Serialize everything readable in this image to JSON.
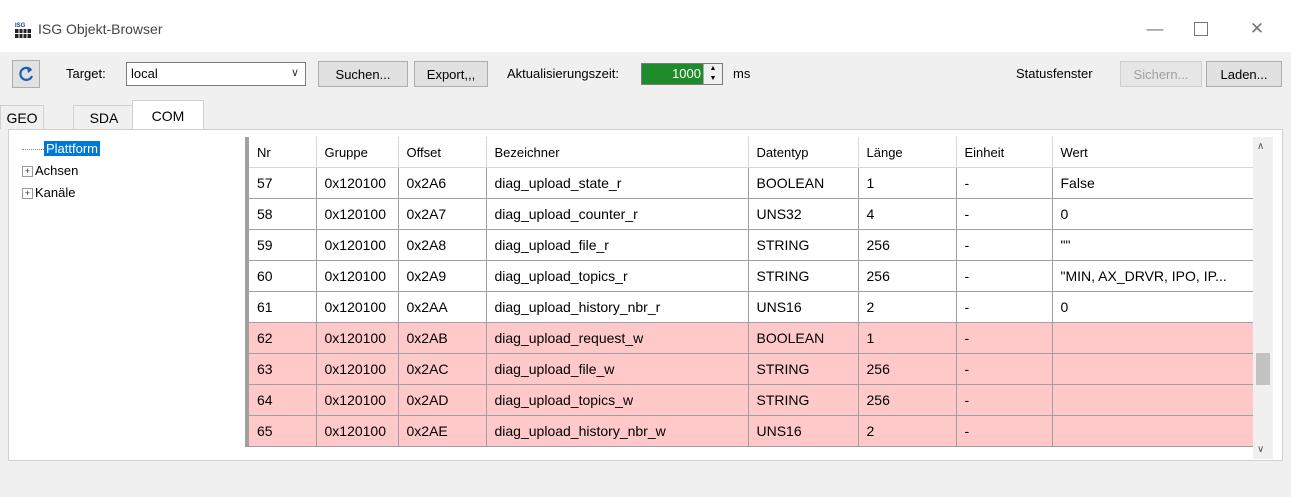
{
  "window": {
    "title": "ISG Objekt-Browser"
  },
  "toolbar": {
    "target_label": "Target:",
    "target_value": "local",
    "search_label": "Suchen...",
    "export_label": "Export,,,",
    "refresh_label": "Aktualisierungszeit:",
    "refresh_value": "1000",
    "refresh_unit": "ms",
    "status_label": "Statusfenster",
    "save_label": "Sichern...",
    "load_label": "Laden..."
  },
  "tabs": [
    "GEO",
    "SDA",
    "COM"
  ],
  "active_tab": "COM",
  "tree": [
    {
      "label": "Plattform",
      "selected": true
    },
    {
      "label": "Achsen",
      "expandable": true
    },
    {
      "label": "Kanäle",
      "expandable": true
    }
  ],
  "table": {
    "columns": [
      "Nr",
      "Gruppe",
      "Offset",
      "Bezeichner",
      "Datentyp",
      "Länge",
      "Einheit",
      "Wert"
    ],
    "rows": [
      {
        "cells": [
          "57",
          "0x120100",
          "0x2A6",
          "diag_upload_state_r",
          "BOOLEAN",
          "1",
          "-",
          "False"
        ],
        "writable": false
      },
      {
        "cells": [
          "58",
          "0x120100",
          "0x2A7",
          "diag_upload_counter_r",
          "UNS32",
          "4",
          "-",
          "0"
        ],
        "writable": false
      },
      {
        "cells": [
          "59",
          "0x120100",
          "0x2A8",
          "diag_upload_file_r",
          "STRING",
          "256",
          "-",
          "\"\""
        ],
        "writable": false
      },
      {
        "cells": [
          "60",
          "0x120100",
          "0x2A9",
          "diag_upload_topics_r",
          "STRING",
          "256",
          "-",
          "\"MIN, AX_DRVR, IPO, IP..."
        ],
        "writable": false
      },
      {
        "cells": [
          "61",
          "0x120100",
          "0x2AA",
          "diag_upload_history_nbr_r",
          "UNS16",
          "2",
          "-",
          "0"
        ],
        "writable": false
      },
      {
        "cells": [
          "62",
          "0x120100",
          "0x2AB",
          "diag_upload_request_w",
          "BOOLEAN",
          "1",
          "-",
          ""
        ],
        "writable": true
      },
      {
        "cells": [
          "63",
          "0x120100",
          "0x2AC",
          "diag_upload_file_w",
          "STRING",
          "256",
          "-",
          ""
        ],
        "writable": true
      },
      {
        "cells": [
          "64",
          "0x120100",
          "0x2AD",
          "diag_upload_topics_w",
          "STRING",
          "256",
          "-",
          ""
        ],
        "writable": true
      },
      {
        "cells": [
          "65",
          "0x120100",
          "0x2AE",
          "diag_upload_history_nbr_w",
          "UNS16",
          "2",
          "-",
          ""
        ],
        "writable": true
      }
    ]
  },
  "colors": {
    "writable_row": "#ffc9c9",
    "refresh_field": "#1f8c2b",
    "selection": "#0078d7"
  }
}
